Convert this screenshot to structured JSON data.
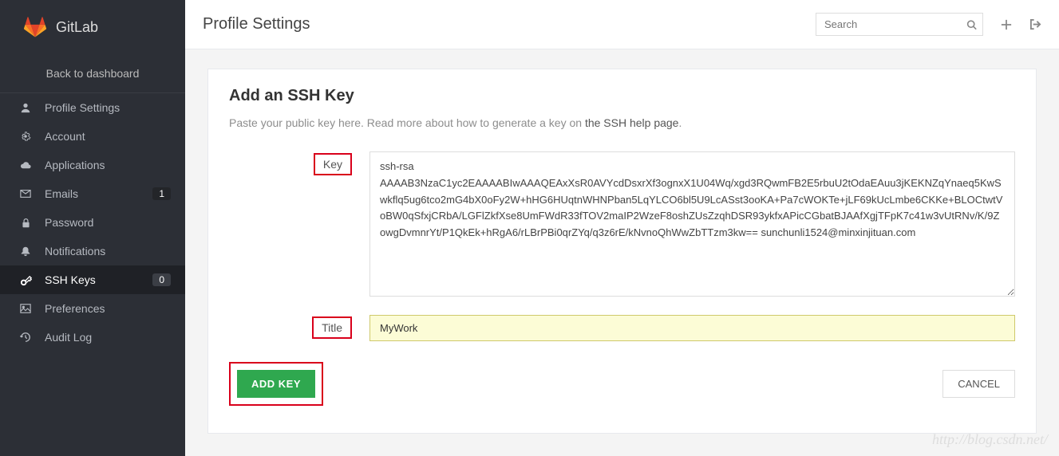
{
  "brand": {
    "name": "GitLab"
  },
  "back_link": "Back to dashboard",
  "sidebar": {
    "items": [
      {
        "icon": "user-icon",
        "label": "Profile Settings",
        "badge": "",
        "active": false
      },
      {
        "icon": "gear-icon",
        "label": "Account",
        "badge": "",
        "active": false
      },
      {
        "icon": "cloud-icon",
        "label": "Applications",
        "badge": "",
        "active": false
      },
      {
        "icon": "envelope-icon",
        "label": "Emails",
        "badge": "1",
        "active": false
      },
      {
        "icon": "lock-icon",
        "label": "Password",
        "badge": "",
        "active": false
      },
      {
        "icon": "bell-icon",
        "label": "Notifications",
        "badge": "",
        "active": false
      },
      {
        "icon": "key-icon",
        "label": "SSH Keys",
        "badge": "0",
        "active": true
      },
      {
        "icon": "image-icon",
        "label": "Preferences",
        "badge": "",
        "active": false
      },
      {
        "icon": "history-icon",
        "label": "Audit Log",
        "badge": "",
        "active": false
      }
    ]
  },
  "header": {
    "title": "Profile Settings",
    "search_placeholder": "Search"
  },
  "panel": {
    "title": "Add an SSH Key",
    "desc_prefix": "Paste your public key here. Read more about how to generate a key on ",
    "help_link_text": "the SSH help page",
    "desc_suffix": "."
  },
  "form": {
    "key_label": "Key",
    "key_value": "ssh-rsa AAAAB3NzaC1yc2EAAAABIwAAAQEAxXsR0AVYcdDsxrXf3ognxX1U04Wq/xgd3RQwmFB2E5rbuU2tOdaEAuu3jKEKNZqYnaeq5KwSwkflq5ug6tco2mG4bX0oFy2W+hHG6HUqtnWHNPban5LqYLCO6bl5U9LcASst3ooKA+Pa7cWOKTe+jLF69kUcLmbe6CKKe+BLOCtwtVoBW0qSfxjCRbA/LGFlZkfXse8UmFWdR33fTOV2maIP2WzeF8oshZUsZzqhDSR93ykfxAPicCGbatBJAAfXgjTFpK7c41w3vUtRNv/K/9ZowgDvmnrYt/P1QkEk+hRgA6/rLBrPBi0qrZYq/q3z6rE/kNvnoQhWwZbTTzm3kw== sunchunli1524@minxinjituan.com",
    "title_label": "Title",
    "title_value": "MyWork",
    "add_button": "ADD KEY",
    "cancel_button": "CANCEL"
  },
  "watermark": "http://blog.csdn.net/"
}
